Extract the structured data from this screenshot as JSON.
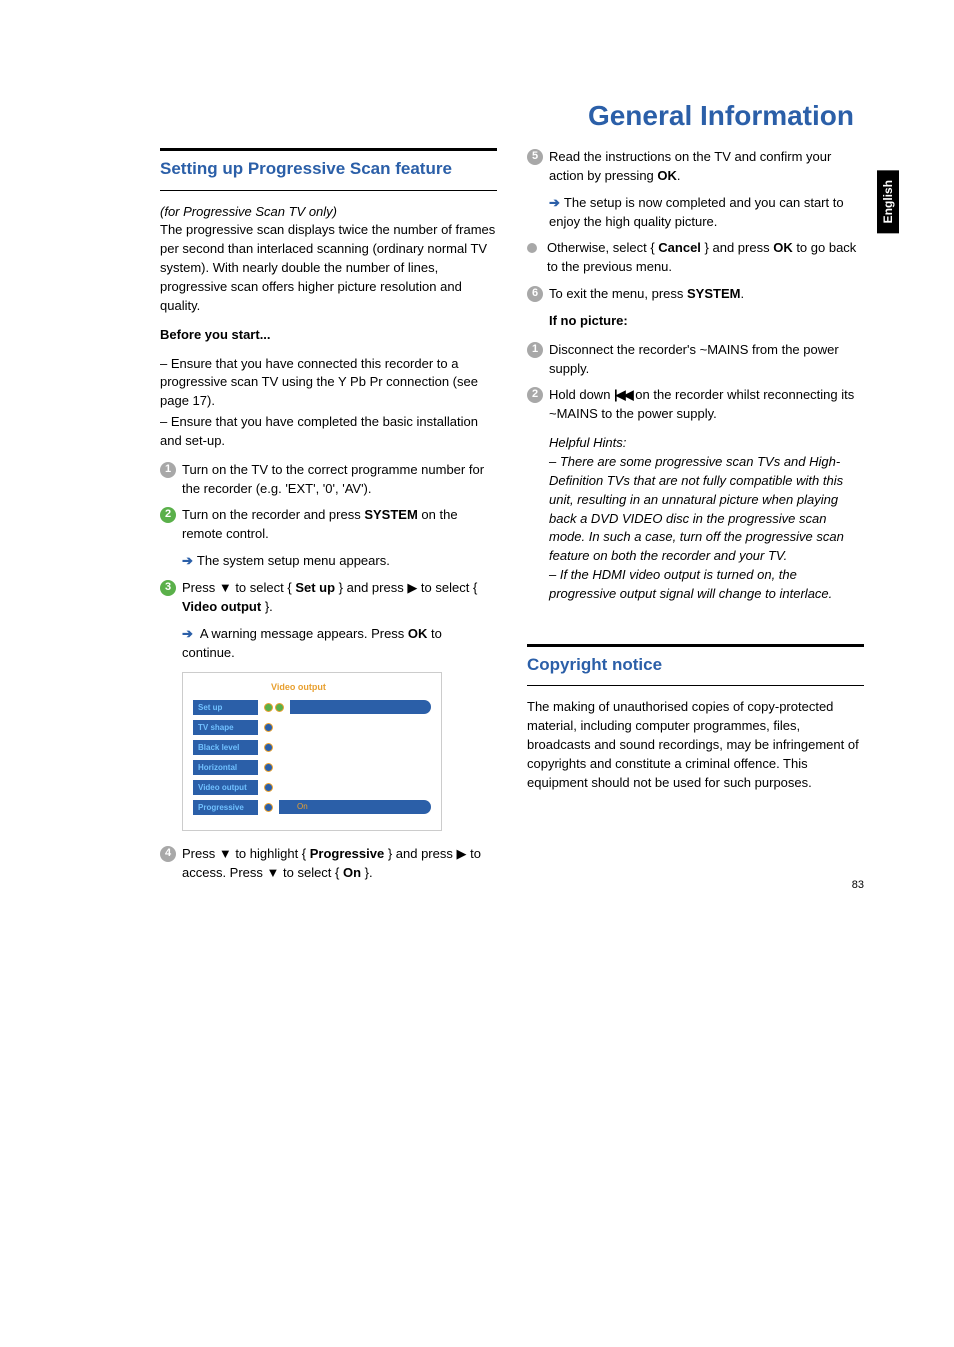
{
  "language_tab": "English",
  "page_title": "General Information",
  "page_number": "83",
  "left": {
    "heading": "Setting up Progressive Scan feature",
    "intro_italic": "(for Progressive Scan TV only)",
    "intro_body": "The progressive scan displays twice the number of frames per second than interlaced scanning (ordinary normal TV system). With nearly double the number of lines, progressive scan offers higher picture resolution and quality.",
    "before_title": "Before you start...",
    "before_1": "– Ensure that you have connected this recorder to a progressive scan TV using the Y Pb Pr connection (see page 17).",
    "before_2": "– Ensure that you have completed the basic installation and set-up.",
    "step1": "Turn on the TV to the correct programme number for the recorder (e.g. 'EXT', '0', 'AV').",
    "step2_a": "Turn on the recorder and press ",
    "step2_b": "SYSTEM",
    "step2_c": " on the remote control.",
    "step2_sub": "The system setup menu appears.",
    "step3_a": "Press ▼ to select { ",
    "step3_b": "Set up",
    "step3_c": " } and press ▶ to select { ",
    "step3_d": "Video output",
    "step3_e": " }.",
    "step3_sub_a": "A warning message appears.  Press ",
    "step3_sub_b": "OK",
    "step3_sub_c": " to continue.",
    "menu": {
      "header": "Video output",
      "items": [
        "Set up",
        "TV shape",
        "Black level",
        "Horizontal",
        "Video output",
        "Progressive"
      ],
      "on_label": "On"
    },
    "step4_a": "Press ▼ to highlight { ",
    "step4_b": "Progressive",
    "step4_c": " } and press ▶ to access.  Press ▼ to select { ",
    "step4_d": "On",
    "step4_e": " }."
  },
  "right": {
    "step5_a": "Read the instructions on the TV and confirm your action by pressing ",
    "step5_b": "OK",
    "step5_c": ".",
    "step5_sub": "The setup is now completed and you can start to enjoy the high quality picture.",
    "bullet_a": "Otherwise, select { ",
    "bullet_b": "Cancel",
    "bullet_c": " } and press ",
    "bullet_d": "OK",
    "bullet_e": " to go back to the previous menu.",
    "step6_a": "To exit the menu, press ",
    "step6_b": "SYSTEM",
    "step6_c": ".",
    "nopic_title": "If no picture:",
    "nopic_step1": "Disconnect the recorder's ~MAINS from the power supply.",
    "nopic_step2_a": "Hold down ",
    "nopic_step2_b": " on the recorder whilst reconnecting its ~MAINS to the power supply.",
    "hints_title": "Helpful Hints:",
    "hints_1": "– There are some progressive scan TVs and High-Definition TVs that are not fully compatible with this unit, resulting in an unnatural picture when playing back a DVD VIDEO disc in the progressive scan mode. In such a case, turn off the progressive scan feature on both the recorder and your TV.",
    "hints_2": "– If the HDMI video output is turned on, the progressive output signal will change to interlace.",
    "copyright_heading": "Copyright notice",
    "copyright_body": "The making of unauthorised copies of copy-protected material, including computer programmes, files, broadcasts and sound recordings, may be infringement of copyrights and constitute a criminal offence.  This equipment should not be used for such purposes."
  }
}
